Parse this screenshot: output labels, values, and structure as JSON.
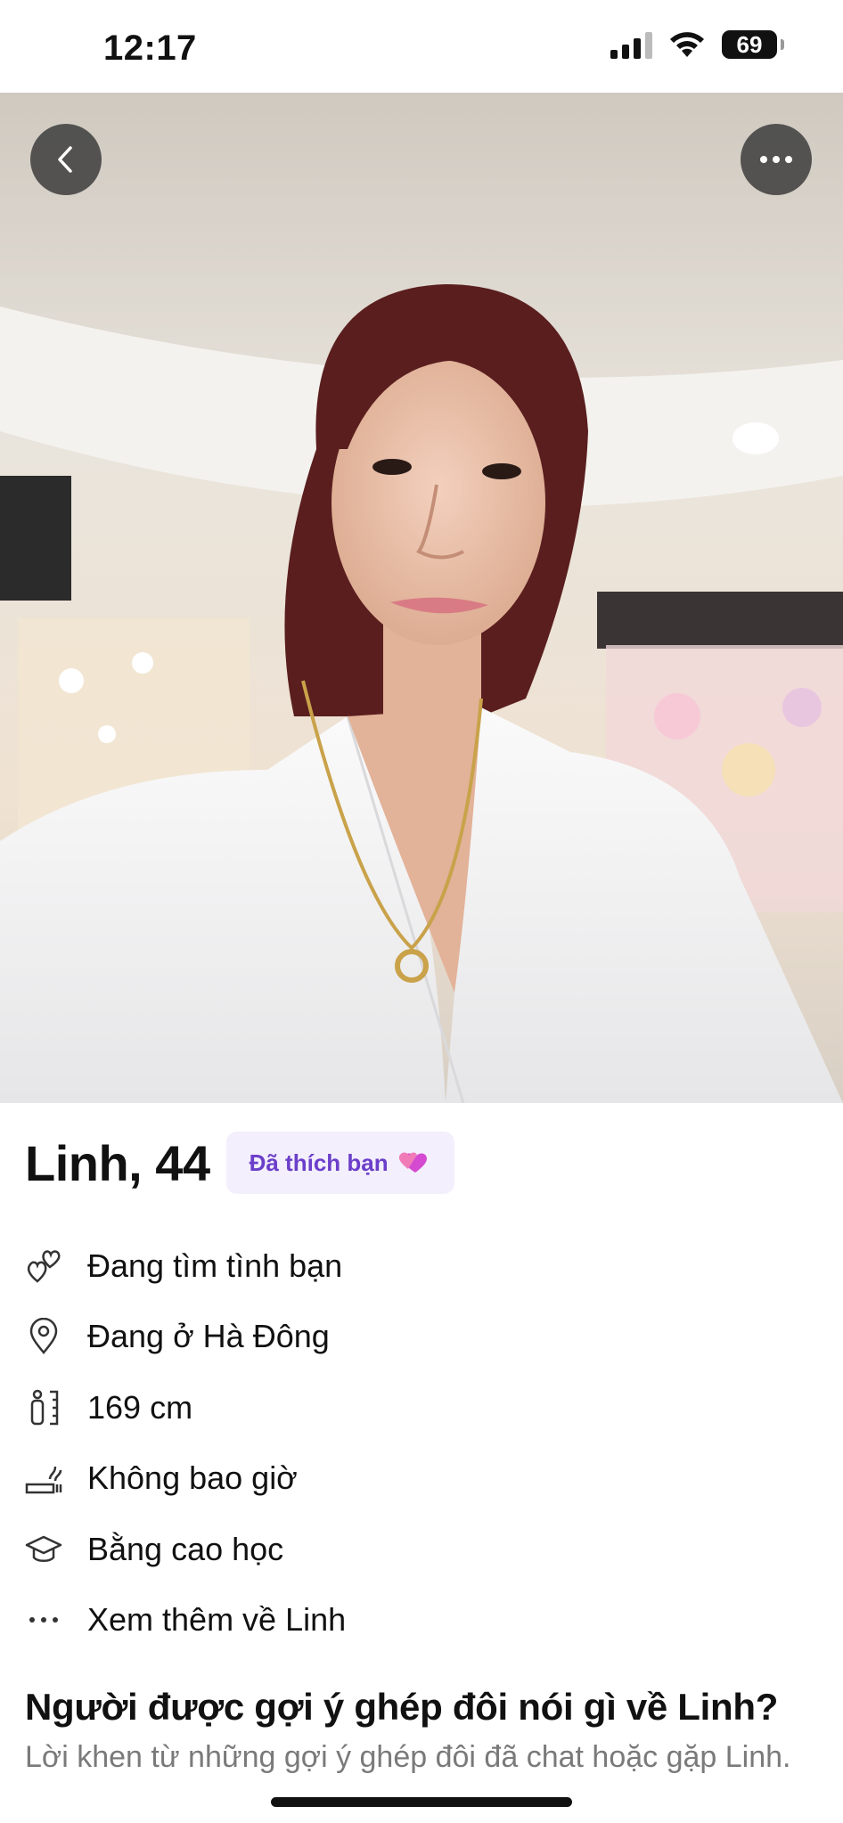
{
  "status_bar": {
    "time": "12:17",
    "battery": "69"
  },
  "profile": {
    "name_age": "Linh, 44",
    "liked_badge": "Đã thích bạn"
  },
  "info": [
    {
      "icon": "hearts-icon",
      "text": "Đang tìm tình bạn"
    },
    {
      "icon": "location-pin-icon",
      "text": "Đang ở Hà Đông"
    },
    {
      "icon": "height-icon",
      "text": "169 cm"
    },
    {
      "icon": "smoking-icon",
      "text": "Không bao giờ"
    },
    {
      "icon": "graduation-cap-icon",
      "text": "Bằng cao học"
    },
    {
      "icon": "more-dots-icon",
      "text": "Xem thêm về Linh"
    }
  ],
  "section": {
    "title": "Người được gợi ý ghép đôi nói gì về Linh?",
    "subtitle": "Lời khen từ những gợi ý ghép đôi đã chat hoặc gặp Linh."
  },
  "colors": {
    "accent": "#6b3fc9",
    "badge_bg": "#f3effd"
  }
}
